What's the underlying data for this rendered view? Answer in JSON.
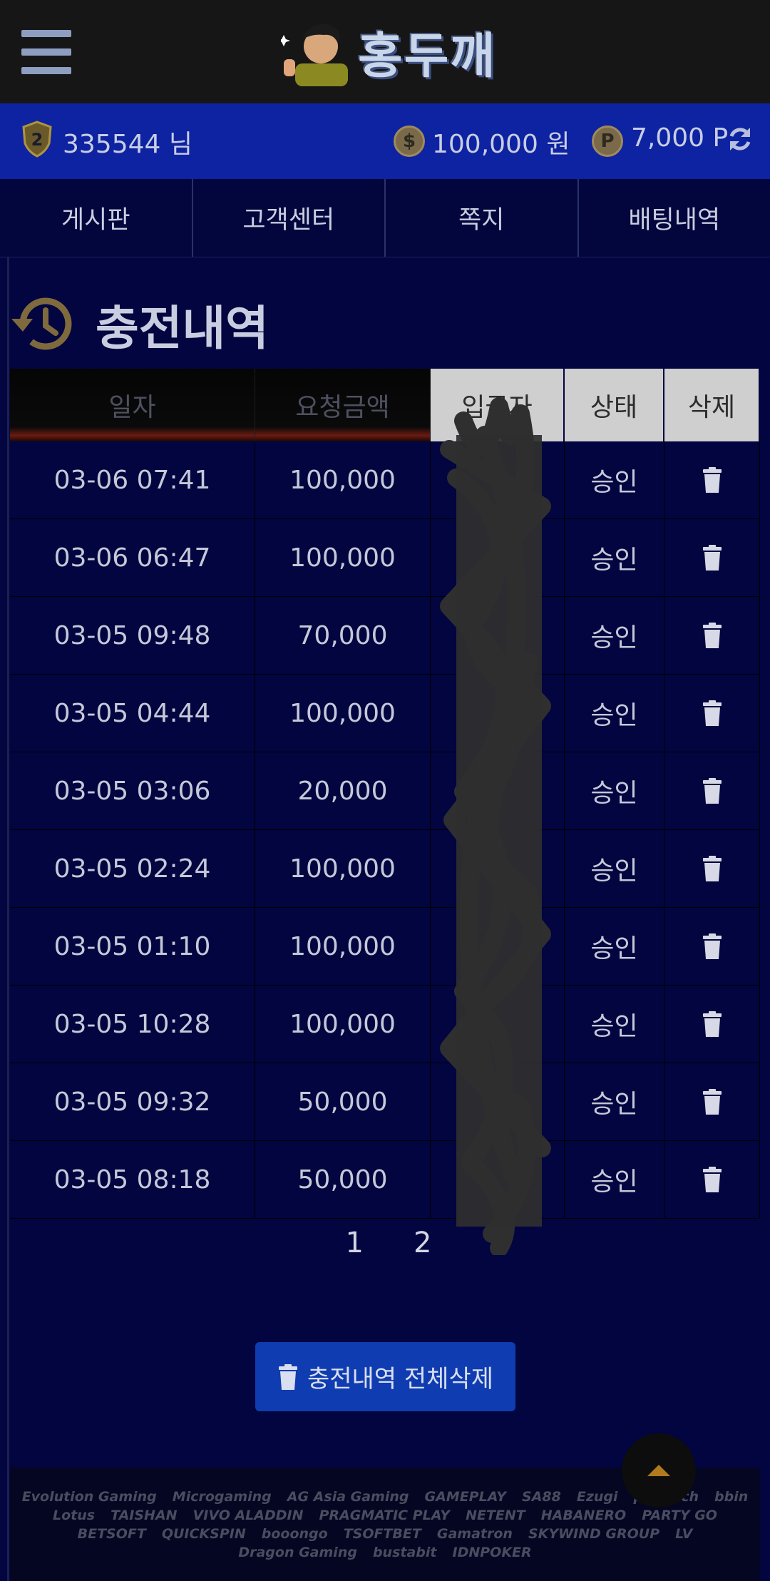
{
  "header": {
    "logo_text": "홍두깨"
  },
  "userbar": {
    "level": "2",
    "user_id": "335544 님",
    "money": "100,000 원",
    "point": "7,000 P"
  },
  "nav": [
    "게시판",
    "고객센터",
    "쪽지",
    "배팅내역"
  ],
  "page": {
    "title": "충전내역"
  },
  "table": {
    "headers": [
      "일자",
      "요청금액",
      "입금자",
      "상태",
      "삭제"
    ],
    "rows": [
      {
        "date": "03-06 07:41",
        "amount": "100,000",
        "status": "승인"
      },
      {
        "date": "03-06 06:47",
        "amount": "100,000",
        "status": "승인"
      },
      {
        "date": "03-05 09:48",
        "amount": "70,000",
        "status": "승인"
      },
      {
        "date": "03-05 04:44",
        "amount": "100,000",
        "status": "승인"
      },
      {
        "date": "03-05 03:06",
        "amount": "20,000",
        "status": "승인"
      },
      {
        "date": "03-05 02:24",
        "amount": "100,000",
        "status": "승인"
      },
      {
        "date": "03-05 01:10",
        "amount": "100,000",
        "status": "승인"
      },
      {
        "date": "03-05 10:28",
        "amount": "100,000",
        "status": "승인"
      },
      {
        "date": "03-05 09:32",
        "amount": "50,000",
        "status": "승인"
      },
      {
        "date": "03-05 08:18",
        "amount": "50,000",
        "status": "승인"
      }
    ]
  },
  "pagination": [
    "1",
    "2"
  ],
  "actions": {
    "delete_all": "충전내역 전체삭제"
  },
  "providers": [
    "Evolution Gaming",
    "Microgaming",
    "AG Asia Gaming",
    "GAMEPLAY",
    "SA88",
    "Ezugi",
    "playtech",
    "bbin",
    "Lotus",
    "TAISHAN",
    "VIVO ALADDIN",
    "PRAGMATIC PLAY",
    "NETENT",
    "HABANERO",
    "PARTY GO",
    "BETSOFT",
    "QUICKSPIN",
    "booongo",
    "TSOFTBET",
    "Gamatron",
    "SKYWIND GROUP",
    "LV",
    "Dragon Gaming",
    "bustabit",
    "IDNPOKER"
  ],
  "colors": {
    "header_bg": "#161616",
    "userbar_bg": "#0d23a1",
    "page_bg": "#02053f",
    "button_bg": "#0f3cb0"
  }
}
